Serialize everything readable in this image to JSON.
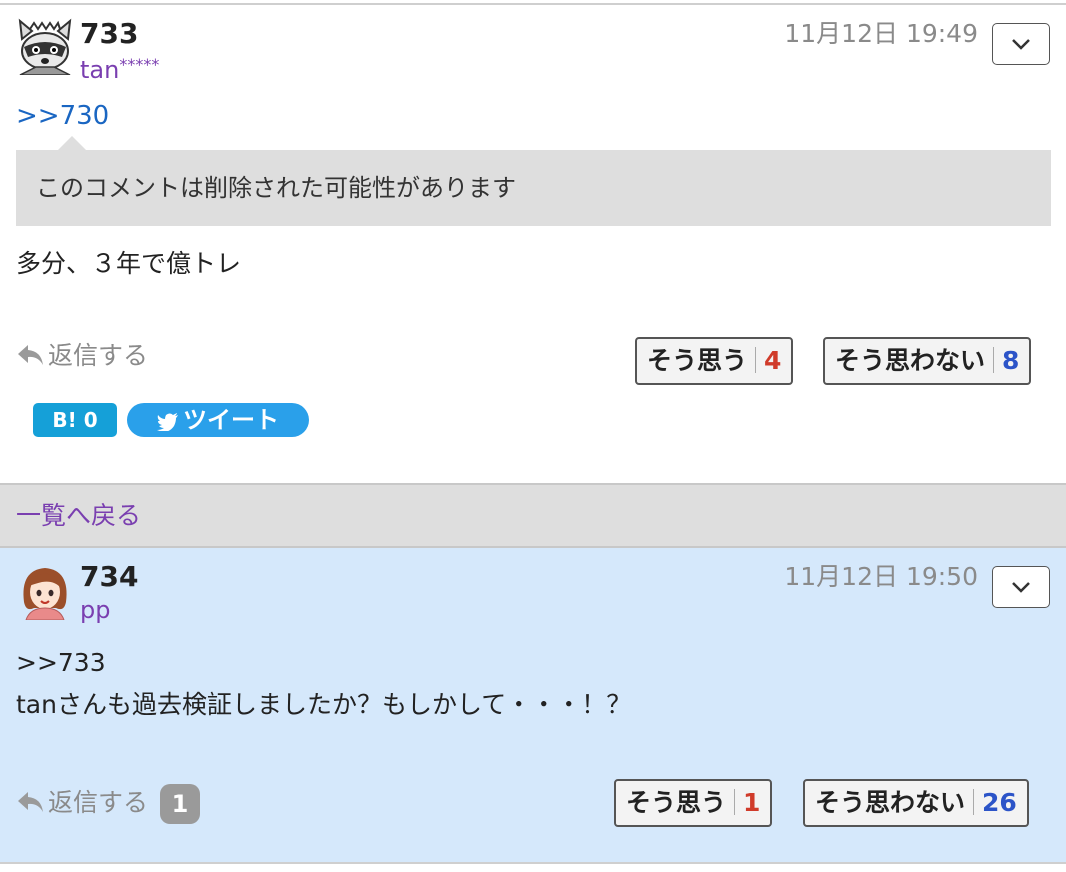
{
  "comments": [
    {
      "number": "733",
      "user": "tan",
      "user_mask": "*****",
      "date": "11月12日 19:49",
      "anchor": ">>730",
      "quote": "このコメントは削除された可能性があります",
      "body": [
        "多分、３年で億トレ"
      ],
      "reply_label": "返信する",
      "agree_label": "そう思う",
      "agree_count": "4",
      "disagree_label": "そう思わない",
      "disagree_count": "8",
      "hatena_label": "B! 0",
      "tweet_label": "ツイート"
    },
    {
      "number": "734",
      "user": "pp",
      "date": "11月12日 19:50",
      "body": [
        ">>733",
        "tanさんも過去検証しましたか？もしかして・・・！？"
      ],
      "reply_label": "返信する",
      "reply_count": "1",
      "agree_label": "そう思う",
      "agree_count": "1",
      "disagree_label": "そう思わない",
      "disagree_count": "26"
    }
  ],
  "back_label": "一覧へ戻る",
  "colors": {
    "username": "#7a3fb0",
    "link": "#1a66c2",
    "agree": "#d03b2a",
    "disagree": "#2c54c8",
    "highlight_bg": "#d5e8fb"
  }
}
